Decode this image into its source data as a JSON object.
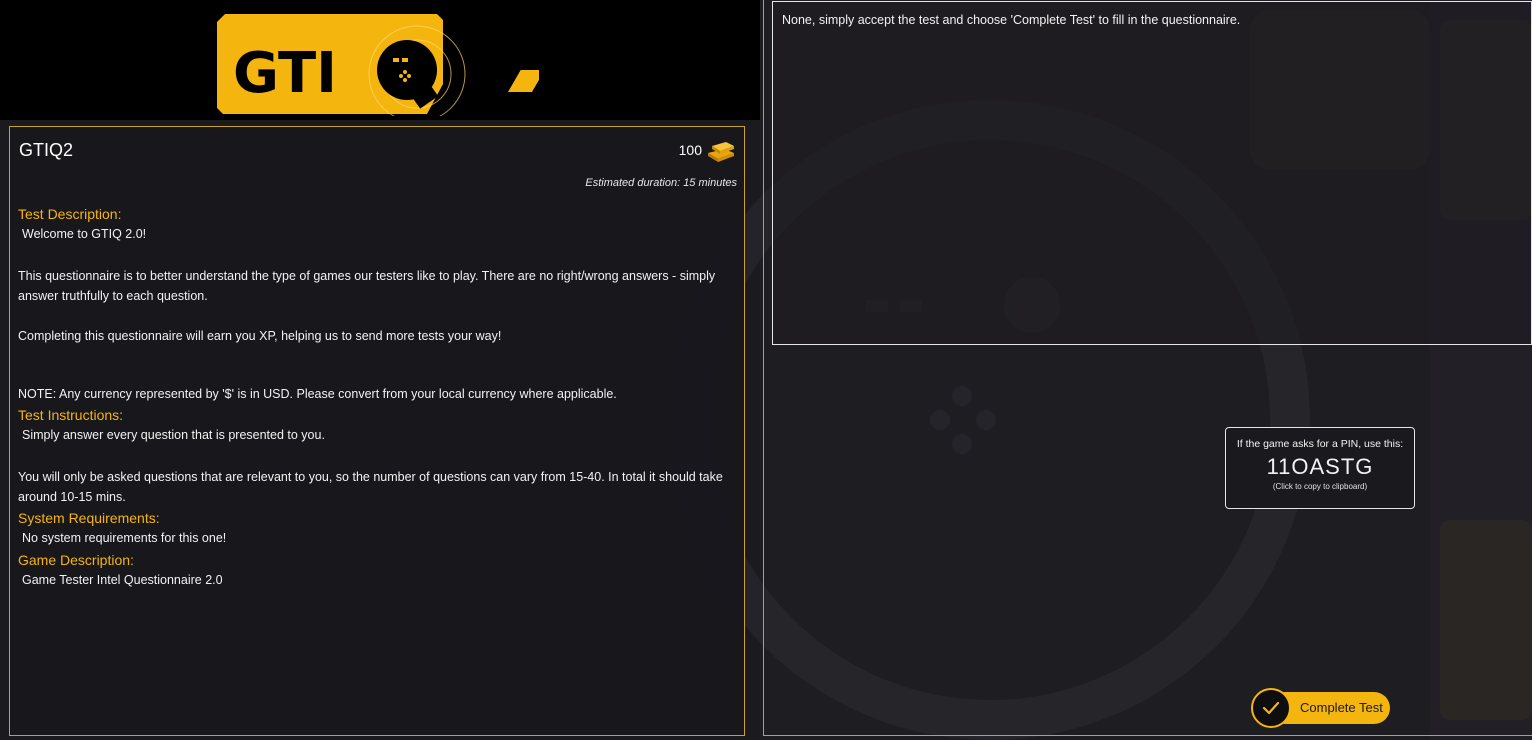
{
  "logo": {
    "text": "GTIQ",
    "version_mark": "2",
    "colors": {
      "brand": "#f5b50f",
      "dark": "#000000"
    }
  },
  "test": {
    "title": "GTIQ2",
    "xp_value": "100",
    "xp_icon": "gold-bars-icon",
    "duration": "Estimated duration: 15 minutes"
  },
  "sections": {
    "description": {
      "heading": "Test Description:",
      "line1": "Welcome to GTIQ 2.0!",
      "line2": "This questionnaire is to better understand the type of games our testers like to play. There are no right/wrong answers - simply answer truthfully to each question.",
      "line3": "Completing this questionnaire will earn you XP, helping us to send more tests your way!",
      "line4": "NOTE: Any currency represented by '$' is in USD. Please convert from your local currency where applicable."
    },
    "instructions": {
      "heading": "Test Instructions:",
      "line1": "Simply answer every question that is presented to you.",
      "line2": "You will only be asked questions that are relevant to you, so the number of questions can vary from 15-40. In total it should take around 10-15 mins."
    },
    "requirements": {
      "heading": "System Requirements:",
      "line1": "No system requirements for this one!"
    },
    "game": {
      "heading": "Game Description:",
      "line1": "Game Tester Intel Questionnaire 2.0"
    }
  },
  "notes": {
    "text": "None, simply accept the test and choose 'Complete Test' to fill in the questionnaire."
  },
  "pin": {
    "label": "If the game asks for a PIN, use this:",
    "code": "11OASTG",
    "hint": "(Click to copy to clipboard)"
  },
  "actions": {
    "complete_label": "Complete Test",
    "complete_icon": "checkmark-icon"
  },
  "colors": {
    "accent": "#f5b50f",
    "panel_border": "#c8a22a",
    "background": "#000000"
  }
}
